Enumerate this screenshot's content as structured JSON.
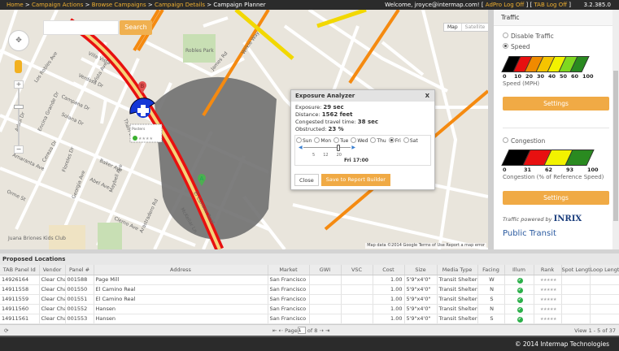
{
  "topbar": {
    "breadcrumbs": [
      "Home",
      "Campaign Actions",
      "Browse Campaigns",
      "Campaign Details"
    ],
    "current": "Campaign Planner",
    "separator": " > ",
    "welcome": "Welcome, jroyce@intermap.com!",
    "adpro_logoff": "AdPro Log Off",
    "tab_logoff": "TAB Log Off",
    "version": "3.2.385.0"
  },
  "map": {
    "search_placeholder": "",
    "search_label": "Search",
    "map_type": [
      "Map",
      "Satellite"
    ],
    "zoom_in": "+",
    "zoom_out": "−",
    "attribution": "Map data ©2014 Google   Terms of Use   Report a map error",
    "marker_b": "B",
    "marker_a": "A",
    "poster_label": "Posters",
    "park": "Robles Park",
    "kids_club": "Juana Briones Kids Club",
    "streets": [
      "Los Robles Ave",
      "Encina Grande Dr",
      "Campana Dr",
      "Verdosa Dr",
      "Vista Ave",
      "Solana Dr",
      "Cereza Dr",
      "Floreles Dr",
      "Georgia Ave",
      "Amaranta Ave",
      "Baker Ave",
      "Abel Ave",
      "Maybell Ave",
      "Arastradero Rd",
      "El Camino Real",
      "McKellar Ln",
      "Orme St",
      "Arbol Dr",
      "Villa Vista",
      "James Rd",
      "Clemo Ave",
      "Wilkie Way",
      "Thain Way",
      "Los Robles Ave"
    ]
  },
  "dialog": {
    "title": "Exposure Analyzer",
    "close_x": "X",
    "exposure_label": "Exposure:",
    "exposure": "29 sec",
    "distance_label": "Distance:",
    "distance": "1562 feet",
    "congested_label": "Congested travel time:",
    "congested": "38 sec",
    "obstructed_label": "Obstructed:",
    "obstructed": "23 %",
    "days": [
      "Sun",
      "Mon",
      "Tue",
      "Wed",
      "Thu",
      "Fri",
      "Sat"
    ],
    "selected_day": "Fri",
    "slider_ticks": [
      "5",
      "12",
      "20"
    ],
    "slider_value": "Fri 17:00",
    "close": "Close",
    "save": "Save to Report Builder"
  },
  "panel": {
    "title": "Traffic",
    "disable": "Disable Traffic",
    "speed": "Speed",
    "speed_ticks": [
      "0",
      "10",
      "20",
      "30",
      "40",
      "50",
      "60",
      "100"
    ],
    "speed_colors": [
      "#000000",
      "#e81010",
      "#f08a00",
      "#f5c400",
      "#f2f200",
      "#7fd820",
      "#2a8a20"
    ],
    "speed_caption": "Speed (MPH)",
    "settings": "Settings",
    "congestion": "Congestion",
    "cong_ticks": [
      "0",
      "31",
      "62",
      "93",
      "100"
    ],
    "cong_colors": [
      "#000000",
      "#e81010",
      "#f2f200",
      "#2a8a20"
    ],
    "cong_caption": "Congestion (% of Reference Speed)",
    "powered": "Traffic powered by",
    "inrix": "INRIX",
    "transit": "Public Transit"
  },
  "grid": {
    "caption": "Proposed Locations",
    "columns": [
      "TAB Panel Id",
      "Vendor",
      "Panel #",
      "Address",
      "Market",
      "GWI",
      "VSC",
      "Cost",
      "Size",
      "Media Type",
      "Facing",
      "Illum",
      "Rank",
      "Spot Length",
      "Loop Length"
    ],
    "rows": [
      [
        "14926164",
        "Clear Channel",
        "001588",
        "Page Mill",
        "San Francisco",
        "",
        "",
        "1.00",
        "5'9\"x4'0\"",
        "Transit Shelters",
        "W",
        "✔",
        "★★★★★",
        "",
        ""
      ],
      [
        "14911558",
        "Clear Channel",
        "001550",
        "El Camino Real",
        "San Francisco",
        "",
        "",
        "1.00",
        "5'9\"x4'0\"",
        "Transit Shelters",
        "N",
        "✔",
        "★★★★★",
        "",
        ""
      ],
      [
        "14911559",
        "Clear Channel",
        "001551",
        "El Camino Real",
        "San Francisco",
        "",
        "",
        "1.00",
        "5'9\"x4'0\"",
        "Transit Shelters",
        "S",
        "✔",
        "★★★★★",
        "",
        ""
      ],
      [
        "14911560",
        "Clear Channel",
        "001552",
        "Hansen",
        "San Francisco",
        "",
        "",
        "1.00",
        "5'9\"x4'0\"",
        "Transit Shelters",
        "N",
        "✔",
        "★★★★★",
        "",
        ""
      ],
      [
        "14911561",
        "Clear Channel",
        "001553",
        "Hansen",
        "San Francisco",
        "",
        "",
        "1.00",
        "5'9\"x4'0\"",
        "Transit Shelters",
        "S",
        "✔",
        "★★★★★",
        "",
        ""
      ]
    ],
    "page_label": "Page",
    "page": "1",
    "of": "of 8",
    "view": "View 1 - 5 of 37"
  },
  "footer": "© 2014 Intermap Technologies"
}
